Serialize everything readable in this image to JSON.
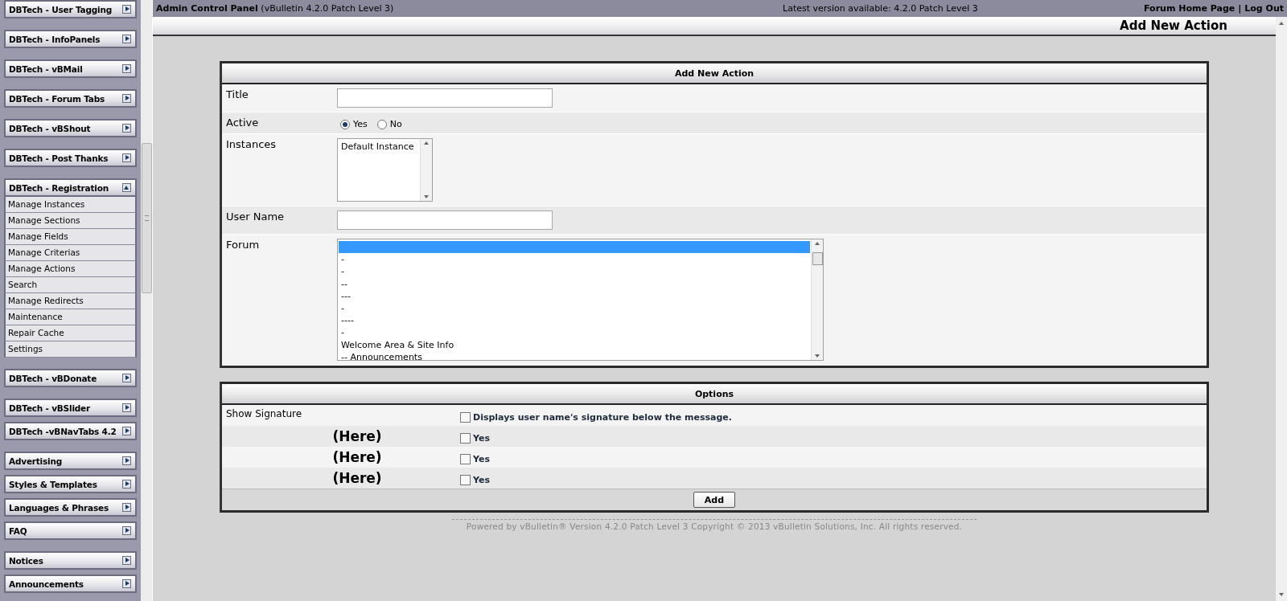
{
  "top_bar": {
    "title": "Admin Control Panel",
    "version": "(vBulletin 4.2.0 Patch Level 3)",
    "latest": "Latest version available: 4.2.0 Patch Level 3",
    "links": [
      "Forum Home Page",
      "Log Out"
    ],
    "separator": "|"
  },
  "page_header": {
    "title": "Add New Action"
  },
  "sidebar": {
    "groups": [
      {
        "items": [
          {
            "label": "DBTech - User Tagging",
            "expanded": false
          }
        ]
      },
      {
        "items": [
          {
            "label": "DBTech - InfoPanels",
            "expanded": false
          }
        ]
      },
      {
        "items": [
          {
            "label": "DBTech - vBMail",
            "expanded": false
          }
        ]
      },
      {
        "items": [
          {
            "label": "DBTech - Forum Tabs",
            "expanded": false
          }
        ]
      },
      {
        "items": [
          {
            "label": "DBTech - vBShout",
            "expanded": false
          }
        ]
      },
      {
        "items": [
          {
            "label": "DBTech - Post Thanks",
            "expanded": false
          }
        ]
      },
      {
        "items": [
          {
            "label": "DBTech - Registration",
            "expanded": true,
            "children": [
              "Manage Instances",
              "Manage Sections",
              "Manage Fields",
              "Manage Criterias",
              "Manage Actions",
              "Search",
              "Manage Redirects",
              "Maintenance",
              "Repair Cache",
              "Settings"
            ]
          }
        ]
      },
      {
        "items": [
          {
            "label": "DBTech - vBDonate",
            "expanded": false
          }
        ]
      },
      {
        "items": [
          {
            "label": "DBTech - vBSlider",
            "expanded": false
          },
          {
            "label": "DBTech -vBNavTabs 4.2",
            "expanded": false
          }
        ]
      },
      {
        "items": [
          {
            "label": "Advertising",
            "expanded": false
          },
          {
            "label": "Styles & Templates",
            "expanded": false
          },
          {
            "label": "Languages & Phrases",
            "expanded": false
          },
          {
            "label": "FAQ",
            "expanded": false
          }
        ]
      },
      {
        "items": [
          {
            "label": "Notices",
            "expanded": false
          },
          {
            "label": "Announcements",
            "expanded": false
          }
        ]
      }
    ]
  },
  "form": {
    "title": "Add New Action",
    "fields": [
      {
        "kind": "text",
        "label": "Title"
      },
      {
        "kind": "radio",
        "label": "Active",
        "options": [
          {
            "label": "Yes",
            "selected": true
          },
          {
            "label": "No",
            "selected": false
          }
        ]
      },
      {
        "kind": "list",
        "label": "Instances",
        "options": [
          {
            "label": "Default Instance",
            "selected": false
          }
        ]
      },
      {
        "kind": "text",
        "label": "User Name"
      },
      {
        "kind": "list",
        "label": "Forum",
        "options": [
          {
            "selected": true
          },
          {
            "label": "-",
            "selected": false
          },
          {
            "label": "-",
            "selected": false
          },
          {
            "label": "--",
            "selected": false
          },
          {
            "label": "---",
            "selected": false
          },
          {
            "label": "-",
            "selected": false
          },
          {
            "label": "----",
            "selected": false
          },
          {
            "label": "-",
            "selected": false
          },
          {
            "label": "Welcome Area & Site Info",
            "selected": false
          },
          {
            "label": "-- Announcements",
            "selected": false
          }
        ]
      }
    ]
  },
  "options": {
    "title": "Options",
    "rows": [
      {
        "kind": "plain",
        "label": "Show Signature",
        "checked": false,
        "text": "Displays user name's signature below the message."
      },
      {
        "kind": "note",
        "label": "(Here)",
        "checked": false,
        "text": "Yes"
      },
      {
        "kind": "note",
        "label": "(Here)",
        "checked": false,
        "text": "Yes"
      },
      {
        "kind": "note",
        "label": "(Here)",
        "checked": false,
        "text": "Yes"
      }
    ],
    "submit": "Add"
  },
  "footer": "Powered by vBulletin® Version 4.2.0 Patch Level 3 Copyright © 2013 vBulletin Solutions, Inc. All rights reserved."
}
